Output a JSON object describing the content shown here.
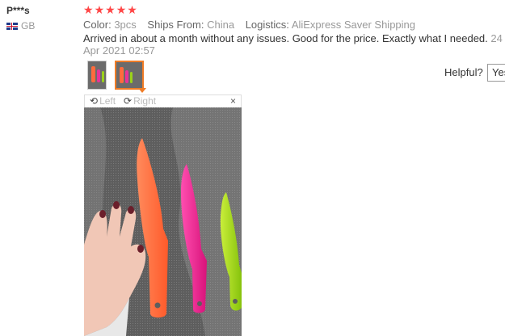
{
  "reviewer": {
    "name": "P***s",
    "country": "GB"
  },
  "rating": {
    "stars": 5
  },
  "meta": {
    "color_label": "Color:",
    "color_value": "3pcs",
    "ships_label": "Ships From:",
    "ships_value": "China",
    "logistics_label": "Logistics:",
    "logistics_value": "AliExpress Saver Shipping"
  },
  "review": {
    "text": "Arrived in about a month without any issues. Good for the price. Exactly what I needed.",
    "date": "24 Apr 2021 02:57"
  },
  "helpful": {
    "label": "Helpful?",
    "yes_label": "Yes"
  },
  "viewer": {
    "rotate_left": "Left",
    "rotate_right": "Right",
    "close": "×"
  },
  "colors": {
    "star": "#ff4747",
    "active_thumb": "#f07c26"
  }
}
